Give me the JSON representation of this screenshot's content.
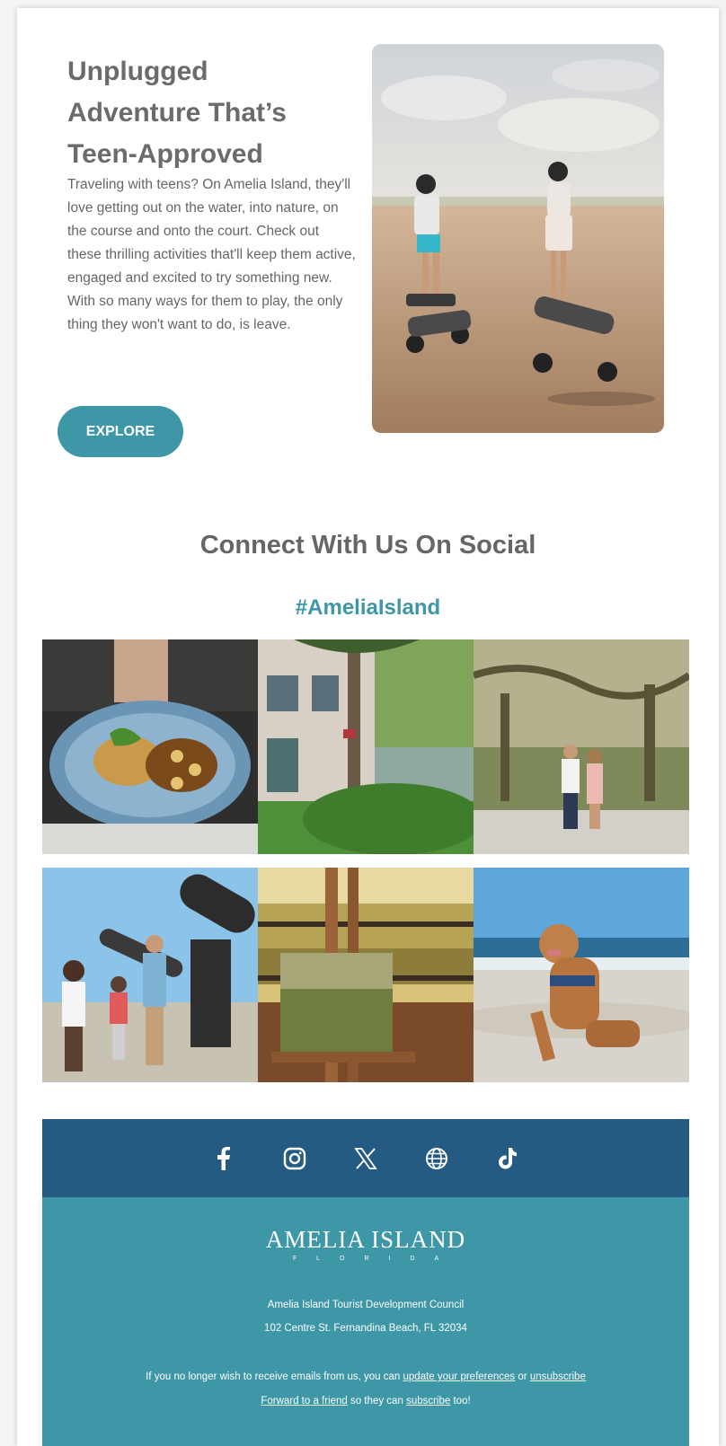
{
  "hero": {
    "title_lines": [
      "Unplugged",
      "Adventure That’s",
      "Teen-Approved"
    ],
    "body": "Traveling with teens? On Amelia Island, they'll love getting out on the water, into nature, on the course and onto the court. Check out these thrilling activities that'll keep them active, engaged and excited to try something new. With so many ways for them to play, the only thing they won't want to do, is leave.",
    "button_label": "EXPLORE",
    "accent_color": "#3d97a7"
  },
  "social": {
    "title": "Connect With Us On Social",
    "hashtag": "#AmeliaIsland",
    "icons": [
      "facebook-icon",
      "instagram-icon",
      "x-icon",
      "globe-icon",
      "tiktok-icon"
    ]
  },
  "footer": {
    "logo_main": "AMELIA ISLAND",
    "logo_sub": "FLORIDA",
    "org": "Amelia Island Tourist Development Council",
    "address": "102 Centre St. Fernandina Beach, FL 32034",
    "unsub_prefix": "If you no longer wish to receive emails from us, you can",
    "unsub_link1": "update your preferences",
    "unsub_or": "or",
    "unsub_link2": "unsubscribe",
    "forward_link": "Forward to a friend",
    "forward_mid": "so they can",
    "forward_link2": "subscribe",
    "forward_end": "too!",
    "bar_color": "#255a83",
    "footer_color": "#3d97a7"
  }
}
